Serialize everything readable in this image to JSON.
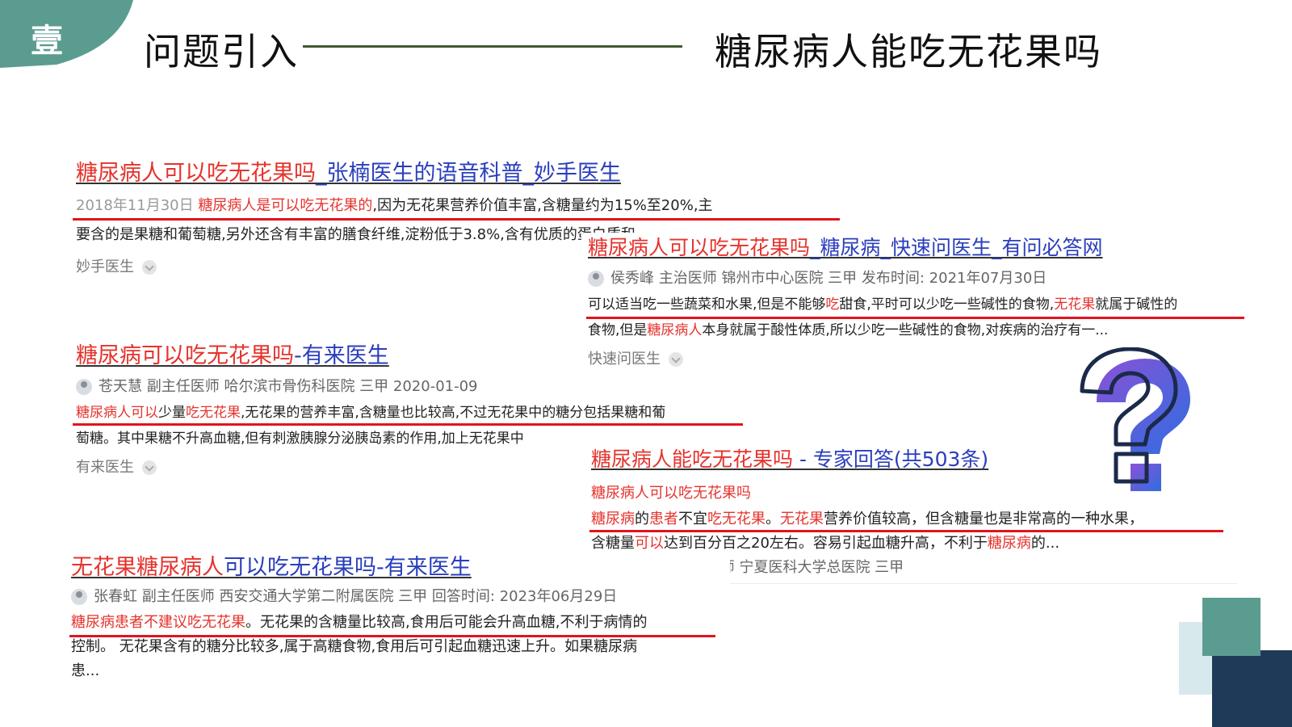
{
  "header": {
    "badge": "壹",
    "section_title": "问题引入",
    "topic": "糖尿病人能吃无花果吗"
  },
  "results": [
    {
      "title_red": "糖尿病人可以吃无花果吗",
      "title_blue": "_张楠医生的语音科普_妙手医生",
      "date": "2018年11月30日",
      "line1_red": "糖尿病人是可以吃无花果的",
      "line1_rest": ",因为无花果营养价值丰富,含糖量约为15%至20%,主",
      "line2": "要含的是果糖和葡萄糖,另外还含有丰富的膳食纤维,淀粉低于3.8%,含有优质的蛋白质和",
      "source": "妙手医生"
    },
    {
      "title_red": "糖尿病人可以吃无花果吗",
      "title_blue": "_糖尿病_快速问医生_有问必答网",
      "meta": "侯秀峰 主治医师 锦州市中心医院 三甲 发布时间: 2021年07月30日",
      "line1_a": "可以适当吃一些蔬菜和水果,但是不能够",
      "line1_red1": "吃",
      "line1_b": "甜食,平时可以少吃一些碱性的食物,",
      "line1_red2": "无花果",
      "line1_c": "就属于碱性的",
      "line2_a": "食物,但是",
      "line2_red": "糖尿病人",
      "line2_b": "本身就属于酸性体质,所以少吃一些碱性的食物,对疾病的治疗有一...",
      "source": "快速问医生"
    },
    {
      "title_red": "糖尿病可以吃无花果吗",
      "title_blue": "-有来医生",
      "meta": "苍天慧 副主任医师 哈尔滨市骨伤科医院 三甲 2020-01-09",
      "line1_red1": "糖尿病人可以",
      "line1_a": "少量",
      "line1_red2": "吃无花果",
      "line1_b": ",无花果的营养丰富,含糖量也比较高,不过无花果中的糖分包括果糖和葡",
      "line2": "萄糖。其中果糖不升高血糖,但有刺激胰腺分泌胰岛素的作用,加上无花果中",
      "source": "有来医生"
    },
    {
      "title_red": "糖尿病人能吃无花果吗",
      "title_blue": " - 专家回答(共503条)",
      "subtitle": "糖尿病人可以吃无花果吗",
      "line1_red1": "糖尿病",
      "line1_a": "的",
      "line1_red2": "患者",
      "line1_b": "不宜",
      "line1_red3": "吃无花果",
      "line1_c": "。",
      "line1_red4": "无花果",
      "line1_d": "营养价值较高，但含糖量也是非常高的一种水果，",
      "line2_a": "含糖量",
      "line2_red": "可以",
      "line2_b": "达到百分百之20左右。容易引起血糖升高，不利于",
      "line2_red2": "糖尿病",
      "line2_c": "的...",
      "meta": "赵月霞 副主任医师 宁夏医科大学总医院 三甲"
    },
    {
      "title_red": "无花果糖尿病人",
      "title_blue": "可以吃无花果吗-有来医生",
      "meta": "张春虹 副主任医师 西安交通大学第二附属医院 三甲 回答时间: 2023年06月29日",
      "line1_red": "糖尿病患者不建议吃无花果",
      "line1_rest": "。无花果的含糖量比较高,食用后可能会升高血糖,不利于病情的",
      "line2": "控制。 无花果含有的糖分比较多,属于高糖食物,食用后可引起血糖迅速上升。如果糖尿病",
      "line3": "患..."
    }
  ],
  "colors": {
    "accent_teal": "#5b9c90",
    "highlight_red": "#e5332d",
    "link_blue": "#2a3ebd",
    "navy": "#1f3a58",
    "question_gradient": [
      "#8a52d6",
      "#2f6de0"
    ]
  }
}
